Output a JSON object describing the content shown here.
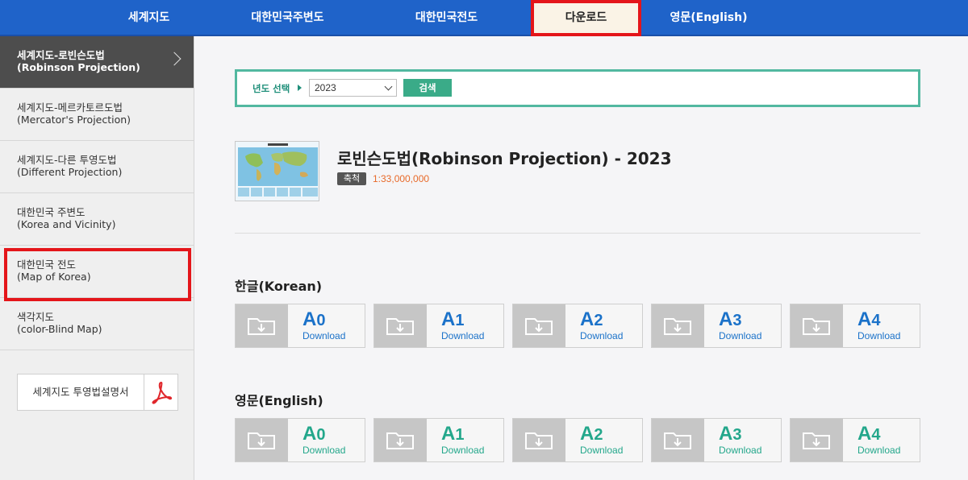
{
  "nav": {
    "tabs": [
      {
        "label": "세계지도"
      },
      {
        "label": "대한민국주변도"
      },
      {
        "label": "대한민국전도"
      },
      {
        "label": "다운로드"
      },
      {
        "label": "영문(English)"
      }
    ]
  },
  "sidebar": {
    "items": [
      {
        "label": "세계지도-로빈슨도법",
        "sub": "(Robinson Projection)"
      },
      {
        "label": "세계지도-메르카토르도법",
        "sub": "(Mercator's Projection)"
      },
      {
        "label": "세계지도-다른 투영도법",
        "sub": "(Different Projection)"
      },
      {
        "label": "대한민국 주변도",
        "sub": "(Korea and Vicinity)"
      },
      {
        "label": "대한민국 전도",
        "sub": "(Map of Korea)"
      },
      {
        "label": "색각지도",
        "sub": "(color-Blind Map)"
      }
    ],
    "pdf_button": "세계지도 투영법설명서"
  },
  "search": {
    "label": "년도 선택",
    "year": "2023",
    "button": "검색"
  },
  "map": {
    "title": "로빈슨도법(Robinson Projection) - 2023",
    "scale_label": "축척",
    "scale_value": "1:33,000,000"
  },
  "sections": {
    "korean": {
      "heading": "한글(Korean)",
      "items": [
        {
          "letter": "A",
          "num": "0",
          "action": "Download"
        },
        {
          "letter": "A",
          "num": "1",
          "action": "Download"
        },
        {
          "letter": "A",
          "num": "2",
          "action": "Download"
        },
        {
          "letter": "A",
          "num": "3",
          "action": "Download"
        },
        {
          "letter": "A",
          "num": "4",
          "action": "Download"
        }
      ]
    },
    "english": {
      "heading": "영문(English)",
      "items": [
        {
          "letter": "A",
          "num": "0",
          "action": "Download"
        },
        {
          "letter": "A",
          "num": "1",
          "action": "Download"
        },
        {
          "letter": "A",
          "num": "2",
          "action": "Download"
        },
        {
          "letter": "A",
          "num": "3",
          "action": "Download"
        },
        {
          "letter": "A",
          "num": "4",
          "action": "Download"
        }
      ]
    }
  },
  "colors": {
    "nav_bg": "#1f63c9",
    "highlight": "#e4151a",
    "korean_accent": "#1b72c9",
    "english_accent": "#23a78b",
    "search_border": "#52b8a0"
  }
}
